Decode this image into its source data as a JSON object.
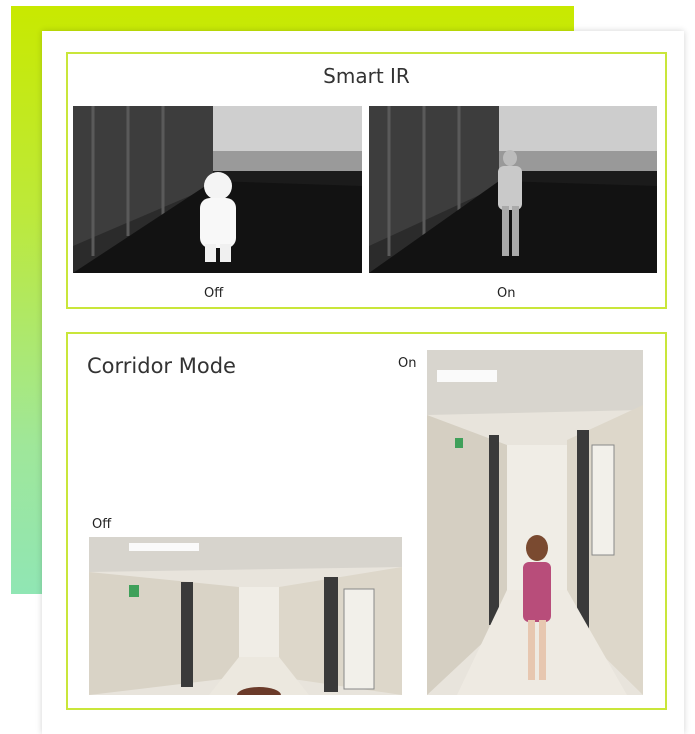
{
  "smart_ir": {
    "title": "Smart IR",
    "off_label": "Off",
    "on_label": "On"
  },
  "corridor": {
    "title": "Corridor Mode",
    "off_label": "Off",
    "on_label": "On"
  },
  "colors": {
    "accent_border": "#c9e63a",
    "bg_gradient_top": "#c8e900",
    "bg_gradient_bottom": "#90e6b4"
  }
}
